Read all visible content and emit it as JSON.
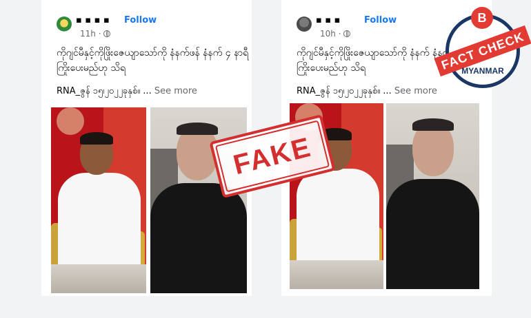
{
  "posts": [
    {
      "author": "▪ ▪ ▪ ▪",
      "follow": "Follow",
      "time": "11h ·",
      "text": "ကိုဂျင်မီနှင့်ကိုဖြိုးဇေယျာသော်ကို နံနက်ဖန် နံနက် ၄ နာရီ ကြိုးပေးမည်ဟု သိရ",
      "meta": "RNA_ဇွန် ၁၅၊၂၀၂၂ခုနှစ်။ ...",
      "see_more": "See more"
    },
    {
      "author": "▪ ▪ ▪",
      "follow": "Follow",
      "time": "10h ·",
      "text": "ကိုဂျင်မီနှင့်ကိုဖြိုးဇေယျာသော်ကို နံနက် နံနက် ၄ နာရီ ကြိုးပေးမည်ဟု သိရ",
      "meta": "RNA_ဇွန် ၁၅၊၂၀၂၂ခုနှစ်။ ...",
      "see_more": "See more"
    }
  ],
  "stamp": {
    "label": "FAKE"
  },
  "badge": {
    "letter": "B",
    "title": "FACT CHECK",
    "subtitle": "MYANMAR"
  },
  "colors": {
    "stamp_red": "#d32f2f",
    "badge_red": "#e23b34",
    "badge_navy": "#1b3766",
    "link_blue": "#1877f2"
  }
}
